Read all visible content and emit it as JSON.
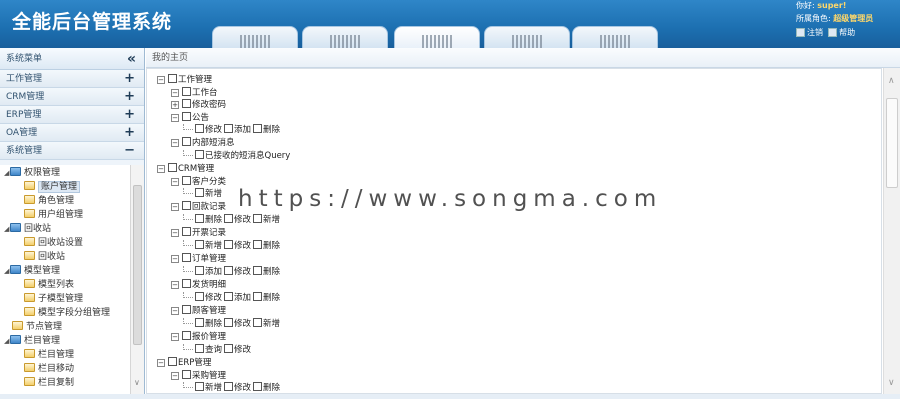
{
  "header": {
    "title": "全能后台管理系统",
    "nav_tabs": [
      "",
      "",
      "",
      "",
      ""
    ],
    "greeting_prefix": "你好:",
    "username": "super!",
    "role_prefix": "所属角色:",
    "role": "超级管理员",
    "logout_label": "注销",
    "help_label": "帮助"
  },
  "sidebar": {
    "title": "系统菜单",
    "collapse_symbol": "«",
    "sections": [
      {
        "label": "工作管理",
        "toggle": "+"
      },
      {
        "label": "CRM管理",
        "toggle": "+"
      },
      {
        "label": "ERP管理",
        "toggle": "+"
      },
      {
        "label": "OA管理",
        "toggle": "+"
      },
      {
        "label": "系统管理",
        "toggle": "−"
      }
    ],
    "tree": [
      {
        "label": "权限管理",
        "type": "folder",
        "arrow": "◢"
      },
      {
        "label": "账户管理",
        "type": "page"
      },
      {
        "label": "角色管理",
        "type": "page"
      },
      {
        "label": "用户组管理",
        "type": "page"
      },
      {
        "label": "回收站",
        "type": "folder",
        "arrow": "◢"
      },
      {
        "label": "回收站设置",
        "type": "page"
      },
      {
        "label": "回收站",
        "type": "page"
      },
      {
        "label": "模型管理",
        "type": "folder",
        "arrow": "◢"
      },
      {
        "label": "模型列表",
        "type": "page"
      },
      {
        "label": "子模型管理",
        "type": "page"
      },
      {
        "label": "模型字段分组管理",
        "type": "page"
      },
      {
        "label": "节点管理",
        "type": "page"
      },
      {
        "label": "栏目管理",
        "type": "folder",
        "arrow": "◢"
      },
      {
        "label": "栏目管理",
        "type": "page"
      },
      {
        "label": "栏目移动",
        "type": "page"
      },
      {
        "label": "栏目复制",
        "type": "page"
      }
    ]
  },
  "main": {
    "breadcrumb": "我的主页",
    "permissions": [
      {
        "label": "工作管理"
      },
      {
        "label": "工作台"
      },
      {
        "label": "修改密码"
      },
      {
        "label": "公告"
      },
      {
        "actions": [
          "修改",
          "添加",
          "删除"
        ]
      },
      {
        "label": "内部短消息"
      },
      {
        "label": "已接收的短消息Query"
      },
      {
        "label": "CRM管理"
      },
      {
        "label": "客户分类"
      },
      {
        "actions": [
          "新增"
        ]
      },
      {
        "label": "回款记录"
      },
      {
        "actions": [
          "删除",
          "修改",
          "新增"
        ]
      },
      {
        "label": "开票记录"
      },
      {
        "actions": [
          "新增",
          "修改",
          "删除"
        ]
      },
      {
        "label": "订单管理"
      },
      {
        "actions": [
          "添加",
          "修改",
          "删除"
        ]
      },
      {
        "label": "发货明细"
      },
      {
        "actions": [
          "修改",
          "添加",
          "删除"
        ]
      },
      {
        "label": "顾客管理"
      },
      {
        "actions": [
          "删除",
          "修改",
          "新增"
        ]
      },
      {
        "label": "报价管理"
      },
      {
        "actions": [
          "查询",
          "修改"
        ]
      },
      {
        "label": "ERP管理"
      },
      {
        "label": "采购管理"
      },
      {
        "actions": [
          "新增",
          "修改",
          "删除"
        ]
      }
    ]
  },
  "watermark": "https://www.songma.com"
}
